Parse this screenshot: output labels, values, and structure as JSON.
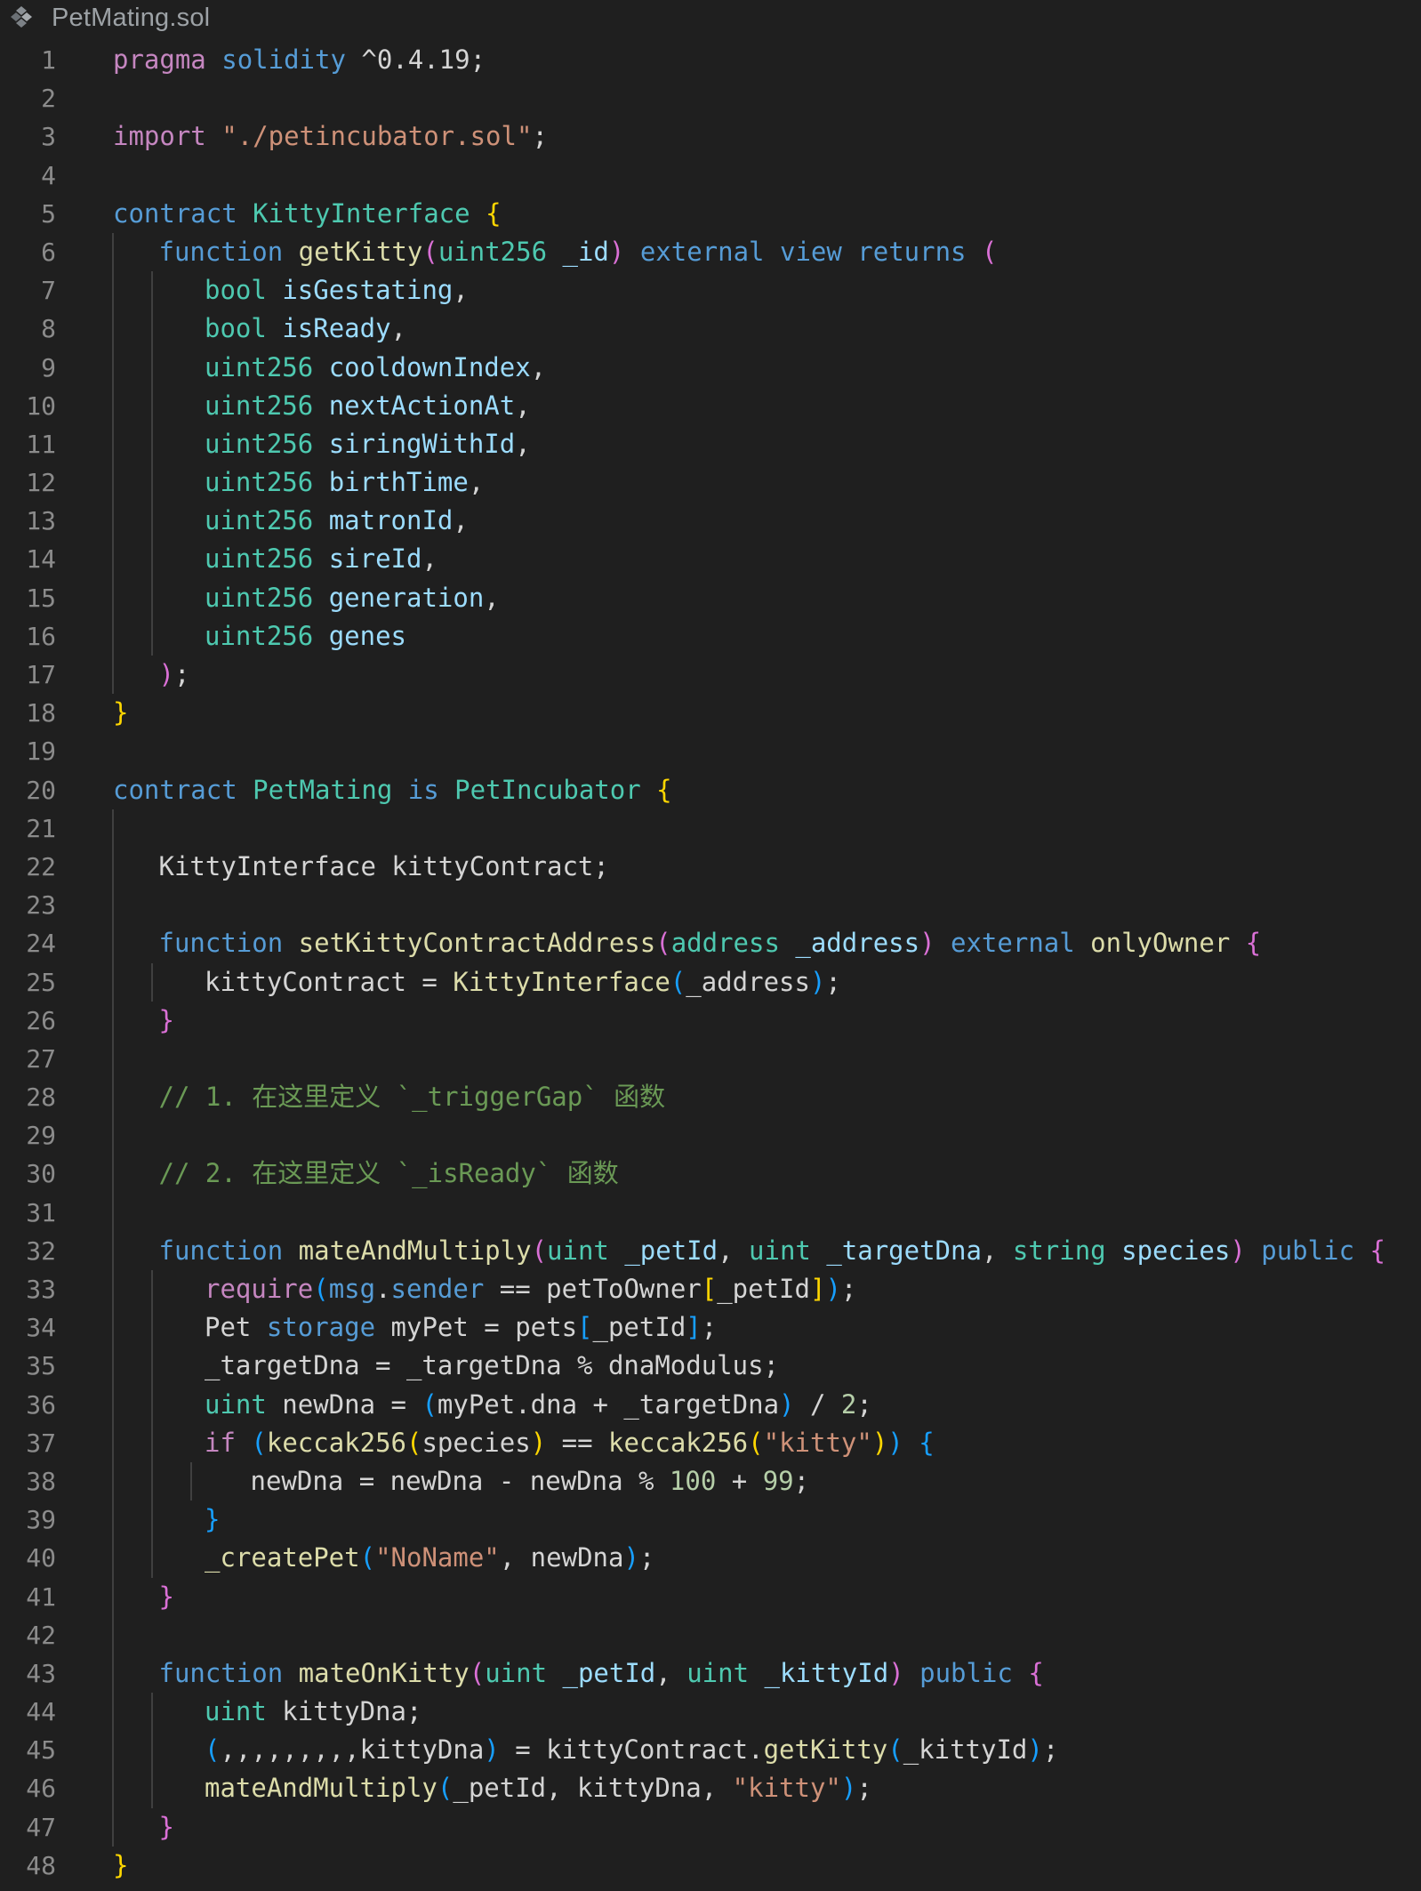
{
  "tab": {
    "file_name": "PetMating.sol",
    "icon": "solidity-file-icon"
  },
  "theme": {
    "background": "#1f1f1f",
    "line_number": "#8b8b8b",
    "keyword": "#c586c0",
    "declaration": "#569cd6",
    "type": "#4ec9b0",
    "function": "#dcdcaa",
    "variable": "#9cdcfe",
    "string": "#ce9178",
    "number": "#b5cea8",
    "comment": "#6a9955",
    "bracket_level_1": "#ffd700",
    "bracket_level_2": "#da70d6",
    "bracket_level_3": "#179fff"
  },
  "code": {
    "lines": [
      {
        "n": "1",
        "guides": 0,
        "tokens": [
          [
            "t-key",
            "pragma"
          ],
          [
            "t-punc",
            " "
          ],
          [
            "t-decl",
            "solidity"
          ],
          [
            "t-punc",
            " ^0.4.19;"
          ]
        ]
      },
      {
        "n": "2",
        "guides": 0,
        "tokens": []
      },
      {
        "n": "3",
        "guides": 0,
        "tokens": [
          [
            "t-key",
            "import"
          ],
          [
            "t-punc",
            " "
          ],
          [
            "t-str",
            "\"./petincubator.sol\""
          ],
          [
            "t-punc",
            ";"
          ]
        ]
      },
      {
        "n": "4",
        "guides": 0,
        "tokens": []
      },
      {
        "n": "5",
        "guides": 0,
        "tokens": [
          [
            "t-decl",
            "contract"
          ],
          [
            "t-punc",
            " "
          ],
          [
            "t-type",
            "KittyInterface"
          ],
          [
            "t-punc",
            " "
          ],
          [
            "t-b1",
            "{"
          ]
        ]
      },
      {
        "n": "6",
        "guides": 1,
        "tokens": [
          [
            "t-decl",
            "function"
          ],
          [
            "t-punc",
            " "
          ],
          [
            "t-fn",
            "getKitty"
          ],
          [
            "t-b2",
            "("
          ],
          [
            "t-type",
            "uint256"
          ],
          [
            "t-punc",
            " "
          ],
          [
            "t-var",
            "_id"
          ],
          [
            "t-b2",
            ")"
          ],
          [
            "t-punc",
            " "
          ],
          [
            "t-decl",
            "external"
          ],
          [
            "t-punc",
            " "
          ],
          [
            "t-decl",
            "view"
          ],
          [
            "t-punc",
            " "
          ],
          [
            "t-decl",
            "returns"
          ],
          [
            "t-punc",
            " "
          ],
          [
            "t-b2",
            "("
          ]
        ]
      },
      {
        "n": "7",
        "guides": 2,
        "tokens": [
          [
            "t-type",
            "bool"
          ],
          [
            "t-punc",
            " "
          ],
          [
            "t-var",
            "isGestating"
          ],
          [
            "t-punc",
            ","
          ]
        ]
      },
      {
        "n": "8",
        "guides": 2,
        "tokens": [
          [
            "t-type",
            "bool"
          ],
          [
            "t-punc",
            " "
          ],
          [
            "t-var",
            "isReady"
          ],
          [
            "t-punc",
            ","
          ]
        ]
      },
      {
        "n": "9",
        "guides": 2,
        "tokens": [
          [
            "t-type",
            "uint256"
          ],
          [
            "t-punc",
            " "
          ],
          [
            "t-var",
            "cooldownIndex"
          ],
          [
            "t-punc",
            ","
          ]
        ]
      },
      {
        "n": "10",
        "guides": 2,
        "tokens": [
          [
            "t-type",
            "uint256"
          ],
          [
            "t-punc",
            " "
          ],
          [
            "t-var",
            "nextActionAt"
          ],
          [
            "t-punc",
            ","
          ]
        ]
      },
      {
        "n": "11",
        "guides": 2,
        "tokens": [
          [
            "t-type",
            "uint256"
          ],
          [
            "t-punc",
            " "
          ],
          [
            "t-var",
            "siringWithId"
          ],
          [
            "t-punc",
            ","
          ]
        ]
      },
      {
        "n": "12",
        "guides": 2,
        "tokens": [
          [
            "t-type",
            "uint256"
          ],
          [
            "t-punc",
            " "
          ],
          [
            "t-var",
            "birthTime"
          ],
          [
            "t-punc",
            ","
          ]
        ]
      },
      {
        "n": "13",
        "guides": 2,
        "tokens": [
          [
            "t-type",
            "uint256"
          ],
          [
            "t-punc",
            " "
          ],
          [
            "t-var",
            "matronId"
          ],
          [
            "t-punc",
            ","
          ]
        ]
      },
      {
        "n": "14",
        "guides": 2,
        "tokens": [
          [
            "t-type",
            "uint256"
          ],
          [
            "t-punc",
            " "
          ],
          [
            "t-var",
            "sireId"
          ],
          [
            "t-punc",
            ","
          ]
        ]
      },
      {
        "n": "15",
        "guides": 2,
        "tokens": [
          [
            "t-type",
            "uint256"
          ],
          [
            "t-punc",
            " "
          ],
          [
            "t-var",
            "generation"
          ],
          [
            "t-punc",
            ","
          ]
        ]
      },
      {
        "n": "16",
        "guides": 2,
        "tokens": [
          [
            "t-type",
            "uint256"
          ],
          [
            "t-punc",
            " "
          ],
          [
            "t-var",
            "genes"
          ]
        ]
      },
      {
        "n": "17",
        "guides": 1,
        "tokens": [
          [
            "t-b2",
            ")"
          ],
          [
            "t-punc",
            ";"
          ]
        ]
      },
      {
        "n": "18",
        "guides": 0,
        "tokens": [
          [
            "t-b1",
            "}"
          ]
        ]
      },
      {
        "n": "19",
        "guides": 0,
        "tokens": []
      },
      {
        "n": "20",
        "guides": 0,
        "tokens": [
          [
            "t-decl",
            "contract"
          ],
          [
            "t-punc",
            " "
          ],
          [
            "t-type",
            "PetMating"
          ],
          [
            "t-punc",
            " "
          ],
          [
            "t-decl",
            "is"
          ],
          [
            "t-punc",
            " "
          ],
          [
            "t-type",
            "PetIncubator"
          ],
          [
            "t-punc",
            " "
          ],
          [
            "t-b1",
            "{"
          ]
        ]
      },
      {
        "n": "21",
        "guides": 1,
        "tokens": []
      },
      {
        "n": "22",
        "guides": 1,
        "tokens": [
          [
            "t-punc",
            "KittyInterface kittyContract;"
          ]
        ]
      },
      {
        "n": "23",
        "guides": 1,
        "tokens": []
      },
      {
        "n": "24",
        "guides": 1,
        "tokens": [
          [
            "t-decl",
            "function"
          ],
          [
            "t-punc",
            " "
          ],
          [
            "t-fn",
            "setKittyContractAddress"
          ],
          [
            "t-b2",
            "("
          ],
          [
            "t-type",
            "address"
          ],
          [
            "t-punc",
            " "
          ],
          [
            "t-var",
            "_address"
          ],
          [
            "t-b2",
            ")"
          ],
          [
            "t-punc",
            " "
          ],
          [
            "t-decl",
            "external"
          ],
          [
            "t-punc",
            " "
          ],
          [
            "t-fn",
            "onlyOwner"
          ],
          [
            "t-punc",
            " "
          ],
          [
            "t-b2",
            "{"
          ]
        ]
      },
      {
        "n": "25",
        "guides": 2,
        "tokens": [
          [
            "t-punc",
            "kittyContract = "
          ],
          [
            "t-fn",
            "KittyInterface"
          ],
          [
            "t-b3",
            "("
          ],
          [
            "t-punc",
            "_address"
          ],
          [
            "t-b3",
            ")"
          ],
          [
            "t-punc",
            ";"
          ]
        ]
      },
      {
        "n": "26",
        "guides": 1,
        "tokens": [
          [
            "t-b2",
            "}"
          ]
        ]
      },
      {
        "n": "27",
        "guides": 1,
        "tokens": []
      },
      {
        "n": "28",
        "guides": 1,
        "tokens": [
          [
            "t-com",
            "// 1. 在这里定义 `_triggerGap` 函数"
          ]
        ]
      },
      {
        "n": "29",
        "guides": 1,
        "tokens": []
      },
      {
        "n": "30",
        "guides": 1,
        "tokens": [
          [
            "t-com",
            "// 2. 在这里定义 `_isReady` 函数"
          ]
        ]
      },
      {
        "n": "31",
        "guides": 1,
        "tokens": []
      },
      {
        "n": "32",
        "guides": 1,
        "tokens": [
          [
            "t-decl",
            "function"
          ],
          [
            "t-punc",
            " "
          ],
          [
            "t-fn",
            "mateAndMultiply"
          ],
          [
            "t-b2",
            "("
          ],
          [
            "t-type",
            "uint"
          ],
          [
            "t-punc",
            " "
          ],
          [
            "t-var",
            "_petId"
          ],
          [
            "t-punc",
            ", "
          ],
          [
            "t-type",
            "uint"
          ],
          [
            "t-punc",
            " "
          ],
          [
            "t-var",
            "_targetDna"
          ],
          [
            "t-punc",
            ", "
          ],
          [
            "t-type",
            "string"
          ],
          [
            "t-punc",
            " "
          ],
          [
            "t-var",
            "species"
          ],
          [
            "t-b2",
            ")"
          ],
          [
            "t-punc",
            " "
          ],
          [
            "t-decl",
            "public"
          ],
          [
            "t-punc",
            " "
          ],
          [
            "t-b2",
            "{"
          ]
        ]
      },
      {
        "n": "33",
        "guides": 2,
        "tokens": [
          [
            "t-key",
            "require"
          ],
          [
            "t-b3",
            "("
          ],
          [
            "t-decl",
            "msg"
          ],
          [
            "t-punc",
            "."
          ],
          [
            "t-decl",
            "sender"
          ],
          [
            "t-punc",
            " == petToOwner"
          ],
          [
            "t-b1",
            "["
          ],
          [
            "t-punc",
            "_petId"
          ],
          [
            "t-b1",
            "]"
          ],
          [
            "t-b3",
            ")"
          ],
          [
            "t-punc",
            ";"
          ]
        ]
      },
      {
        "n": "34",
        "guides": 2,
        "tokens": [
          [
            "t-punc",
            "Pet "
          ],
          [
            "t-decl",
            "storage"
          ],
          [
            "t-punc",
            " myPet = pets"
          ],
          [
            "t-b3",
            "["
          ],
          [
            "t-punc",
            "_petId"
          ],
          [
            "t-b3",
            "]"
          ],
          [
            "t-punc",
            ";"
          ]
        ]
      },
      {
        "n": "35",
        "guides": 2,
        "tokens": [
          [
            "t-punc",
            "_targetDna = _targetDna % dnaModulus;"
          ]
        ]
      },
      {
        "n": "36",
        "guides": 2,
        "tokens": [
          [
            "t-type",
            "uint"
          ],
          [
            "t-punc",
            " newDna = "
          ],
          [
            "t-b3",
            "("
          ],
          [
            "t-punc",
            "myPet.dna + _targetDna"
          ],
          [
            "t-b3",
            ")"
          ],
          [
            "t-punc",
            " / "
          ],
          [
            "t-num",
            "2"
          ],
          [
            "t-punc",
            ";"
          ]
        ]
      },
      {
        "n": "37",
        "guides": 2,
        "tokens": [
          [
            "t-key",
            "if"
          ],
          [
            "t-punc",
            " "
          ],
          [
            "t-b3",
            "("
          ],
          [
            "t-fn",
            "keccak256"
          ],
          [
            "t-b1",
            "("
          ],
          [
            "t-punc",
            "species"
          ],
          [
            "t-b1",
            ")"
          ],
          [
            "t-punc",
            " == "
          ],
          [
            "t-fn",
            "keccak256"
          ],
          [
            "t-b1",
            "("
          ],
          [
            "t-str",
            "\"kitty\""
          ],
          [
            "t-b1",
            ")"
          ],
          [
            "t-b3",
            ")"
          ],
          [
            "t-punc",
            " "
          ],
          [
            "t-b3",
            "{"
          ]
        ]
      },
      {
        "n": "38",
        "guides": 3,
        "tokens": [
          [
            "t-punc",
            "newDna = newDna - newDna % "
          ],
          [
            "t-num",
            "100"
          ],
          [
            "t-punc",
            " + "
          ],
          [
            "t-num",
            "99"
          ],
          [
            "t-punc",
            ";"
          ]
        ]
      },
      {
        "n": "39",
        "guides": 2,
        "tokens": [
          [
            "t-b3",
            "}"
          ]
        ]
      },
      {
        "n": "40",
        "guides": 2,
        "tokens": [
          [
            "t-fn",
            "_createPet"
          ],
          [
            "t-b3",
            "("
          ],
          [
            "t-str",
            "\"NoName\""
          ],
          [
            "t-punc",
            ", newDna"
          ],
          [
            "t-b3",
            ")"
          ],
          [
            "t-punc",
            ";"
          ]
        ]
      },
      {
        "n": "41",
        "guides": 1,
        "tokens": [
          [
            "t-b2",
            "}"
          ]
        ]
      },
      {
        "n": "42",
        "guides": 1,
        "tokens": []
      },
      {
        "n": "43",
        "guides": 1,
        "tokens": [
          [
            "t-decl",
            "function"
          ],
          [
            "t-punc",
            " "
          ],
          [
            "t-fn",
            "mateOnKitty"
          ],
          [
            "t-b2",
            "("
          ],
          [
            "t-type",
            "uint"
          ],
          [
            "t-punc",
            " "
          ],
          [
            "t-var",
            "_petId"
          ],
          [
            "t-punc",
            ", "
          ],
          [
            "t-type",
            "uint"
          ],
          [
            "t-punc",
            " "
          ],
          [
            "t-var",
            "_kittyId"
          ],
          [
            "t-b2",
            ")"
          ],
          [
            "t-punc",
            " "
          ],
          [
            "t-decl",
            "public"
          ],
          [
            "t-punc",
            " "
          ],
          [
            "t-b2",
            "{"
          ]
        ]
      },
      {
        "n": "44",
        "guides": 2,
        "tokens": [
          [
            "t-type",
            "uint"
          ],
          [
            "t-punc",
            " kittyDna;"
          ]
        ]
      },
      {
        "n": "45",
        "guides": 2,
        "tokens": [
          [
            "t-b3",
            "("
          ],
          [
            "t-punc",
            ",,,,,,,,,kittyDna"
          ],
          [
            "t-b3",
            ")"
          ],
          [
            "t-punc",
            " = kittyContract."
          ],
          [
            "t-fn",
            "getKitty"
          ],
          [
            "t-b3",
            "("
          ],
          [
            "t-punc",
            "_kittyId"
          ],
          [
            "t-b3",
            ")"
          ],
          [
            "t-punc",
            ";"
          ]
        ]
      },
      {
        "n": "46",
        "guides": 2,
        "tokens": [
          [
            "t-fn",
            "mateAndMultiply"
          ],
          [
            "t-b3",
            "("
          ],
          [
            "t-punc",
            "_petId, kittyDna, "
          ],
          [
            "t-str",
            "\"kitty\""
          ],
          [
            "t-b3",
            ")"
          ],
          [
            "t-punc",
            ";"
          ]
        ]
      },
      {
        "n": "47",
        "guides": 1,
        "tokens": [
          [
            "t-b2",
            "}"
          ]
        ]
      },
      {
        "n": "48",
        "guides": 0,
        "tokens": [
          [
            "t-b1",
            "}"
          ]
        ]
      }
    ]
  }
}
